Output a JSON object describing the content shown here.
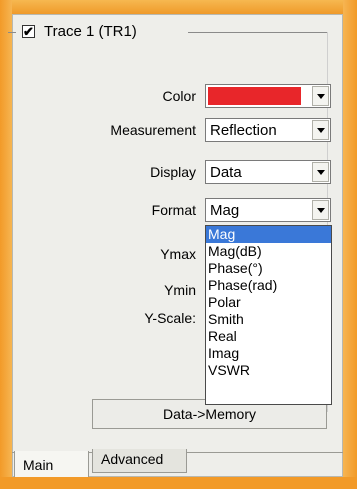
{
  "colors": {
    "frame": "#f0a030",
    "panel": "#eeeeea",
    "trace_color": "#e8262a",
    "selection": "#3a78d8"
  },
  "trace_group": {
    "checked": true,
    "check_mark": "✔",
    "title": "Trace 1 (TR1)"
  },
  "fields": {
    "color": {
      "label": "Color"
    },
    "measurement": {
      "label": "Measurement",
      "value": "Reflection"
    },
    "display": {
      "label": "Display",
      "value": "Data"
    },
    "format": {
      "label": "Format",
      "value": "Mag"
    },
    "ymax": {
      "label": "Ymax"
    },
    "ymin": {
      "label": "Ymin"
    },
    "yscale": {
      "label": "Y-Scale:"
    }
  },
  "format_dropdown": {
    "options": [
      "Mag",
      "Mag(dB)",
      "Phase(°)",
      "Phase(rad)",
      "Polar",
      "Smith",
      "Real",
      "Imag",
      "VSWR"
    ],
    "selected": "Mag"
  },
  "data_memory_button": {
    "label": "Data->Memory"
  },
  "tabs": [
    {
      "label": "Main",
      "active": true
    },
    {
      "label": "Advanced",
      "active": false
    }
  ]
}
